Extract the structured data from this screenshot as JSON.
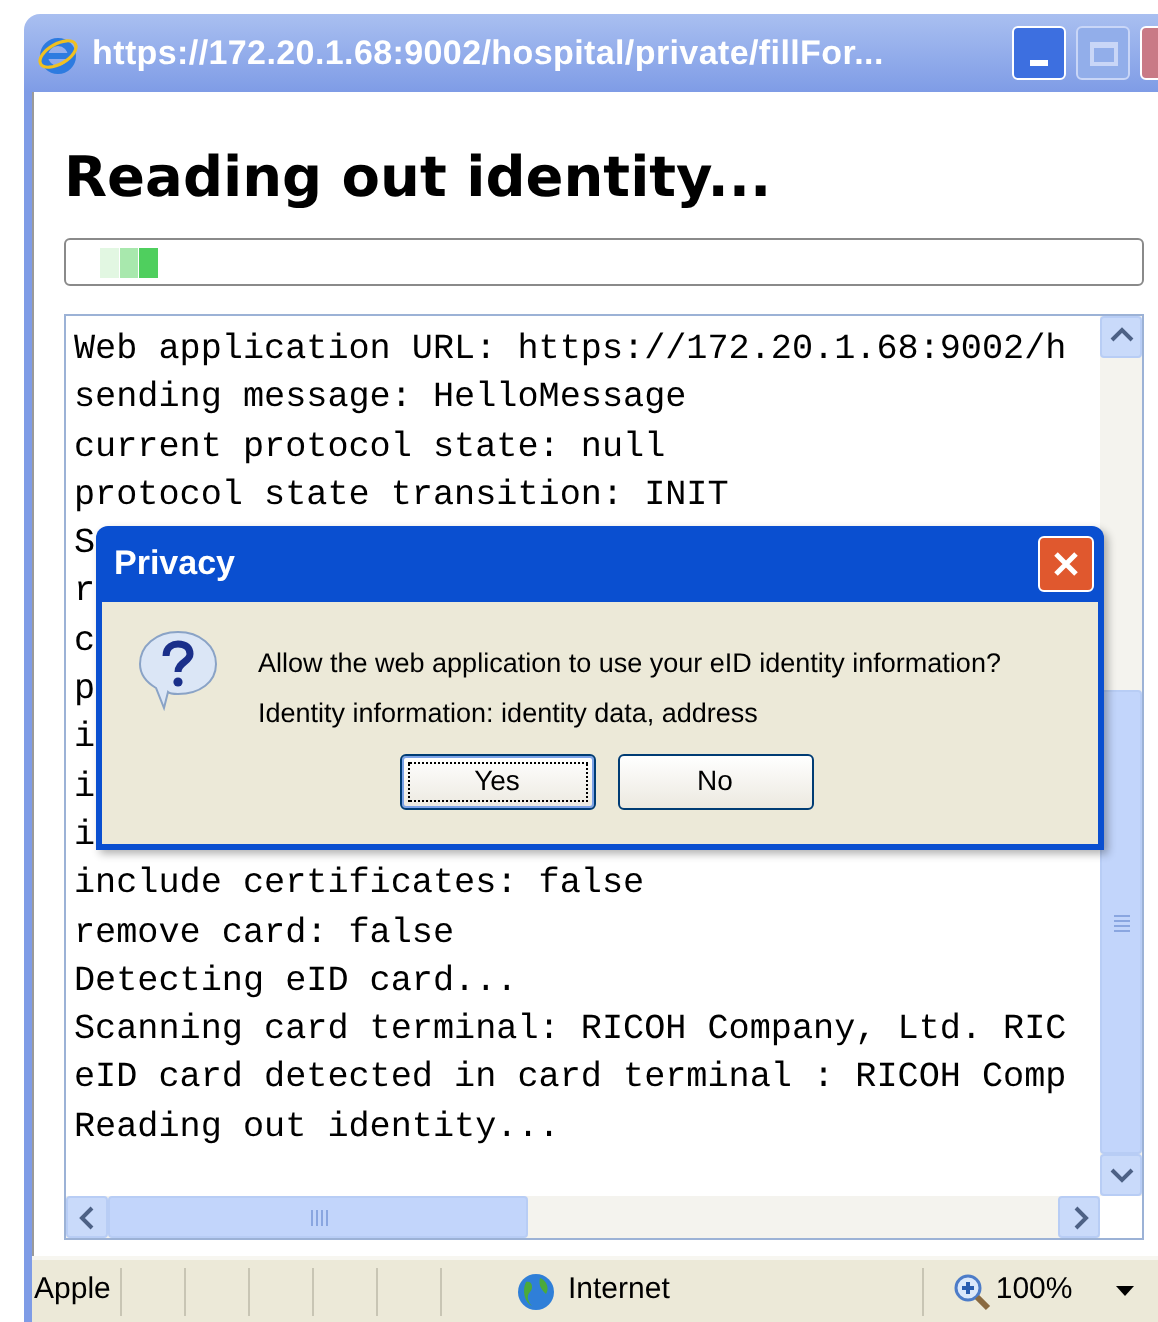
{
  "window": {
    "title": "https://172.20.1.68:9002/hospital/private/fillFor..."
  },
  "heading": "Reading out identity...",
  "progress": {
    "level": 0.056
  },
  "log": {
    "lines": [
      "Web application URL: https://172.20.1.68:9002/h",
      "sending message: HelloMessage",
      "current protocol state: null",
      "protocol state transition: INIT",
      "S",
      "r",
      "c",
      "p",
      "i",
      "i",
      "i",
      "include certificates: false",
      "remove card: false",
      "Detecting eID card...",
      "Scanning card terminal: RICOH Company, Ltd. RIC",
      "eID card detected in card terminal : RICOH Comp",
      "Reading out identity..."
    ]
  },
  "dialog": {
    "title": "Privacy",
    "message": "Allow the web application to use your eID identity information?",
    "detail": "Identity information: identity data, address",
    "buttons": [
      {
        "label": "Yes",
        "selected": true
      },
      {
        "label": "No",
        "selected": false
      }
    ]
  },
  "status_bar": {
    "text": "Apple",
    "zone": "Internet",
    "zoom": "100%"
  }
}
